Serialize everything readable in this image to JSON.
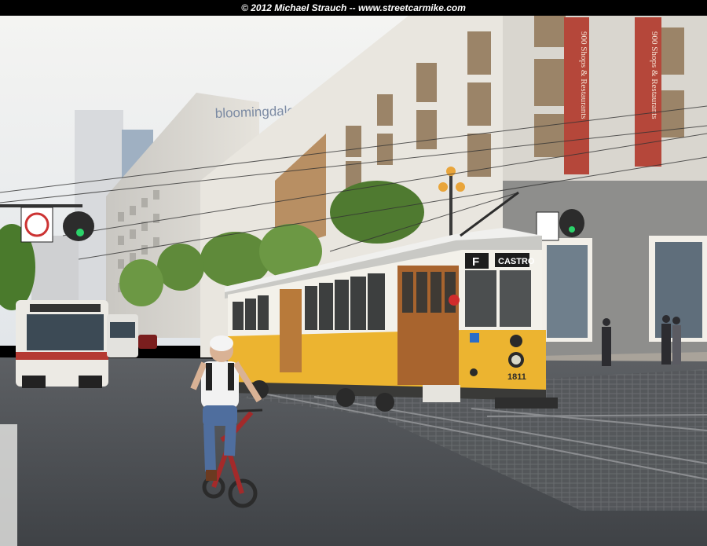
{
  "copyright": "© 2012 Michael Strauch -- www.streetcarmike.com",
  "store_sign": "bloomingdale's",
  "banners": [
    "900 Shops & Restaurants",
    "900 Shops & Restaurants"
  ],
  "streetcar": {
    "route_letter": "F",
    "destination": "CASTRO",
    "car_number": "1811"
  }
}
